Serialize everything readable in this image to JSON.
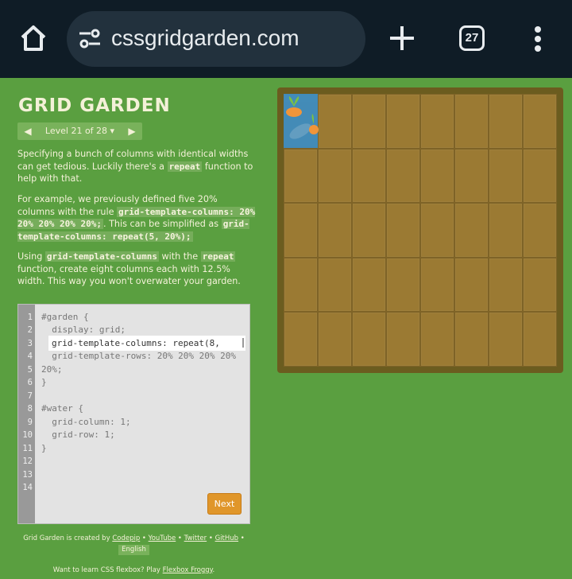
{
  "browser": {
    "url": "cssgridgarden.com",
    "tab_count": "27",
    "icons": [
      "home-icon",
      "site-info-icon",
      "new-tab-icon",
      "tab-switcher-icon",
      "more-menu-icon"
    ]
  },
  "game": {
    "title": "GRID GARDEN",
    "level_label": "Level 21 of 28 ▾",
    "instructions": {
      "p1_before": "Specifying a bunch of columns with identical widths can get tedious. Luckily there's a ",
      "p1_code": "repeat",
      "p1_after": " function to help with that.",
      "p2_before": "For example, we previously defined five 20% columns with the rule ",
      "p2_code1": "grid-template-columns: 20% 20% 20% 20% 20%;",
      "p2_mid": ". This can be simplified as ",
      "p2_code2": "grid-template-columns: repeat(5, 20%);",
      "p3_before": "Using ",
      "p3_code1": "grid-template-columns",
      "p3_mid": " with the ",
      "p3_code2": "repeat",
      "p3_after": " function, create eight columns each with 12.5% width. This way you won't overwater your garden."
    },
    "editor": {
      "line_numbers": [
        "1",
        "2",
        "3",
        "4",
        "5",
        "6",
        "7",
        "8",
        "9",
        "10",
        "11",
        "12",
        "13",
        "14"
      ],
      "lines": {
        "l1": "#garden {",
        "l2": "  display: grid;",
        "l4": "  grid-template-rows: 20% 20% 20% 20%",
        "l5": "20%;",
        "l6": "}",
        "l8": "#water {",
        "l9": "  grid-column: 1;",
        "l10": "  grid-row: 1;",
        "l11": "}"
      },
      "input_value": "grid-template-columns: repeat(8,",
      "next_label": "Next"
    },
    "credits": {
      "prefix": "Grid Garden is created by ",
      "codepip": "Codepip",
      "sep1": " • ",
      "youtube": "YouTube",
      "sep2": " • ",
      "twitter": "Twitter",
      "sep3": " • ",
      "github": "GitHub",
      "sep4": " •",
      "language": "English"
    },
    "promo": {
      "text": "Want to learn CSS flexbox? Play ",
      "link": "Flexbox Froggy",
      "end": "."
    },
    "garden": {
      "columns": 8,
      "rows": 5,
      "colors": {
        "soil": "#9b7a33",
        "border": "#6b5c1f",
        "water": "#3c8dc3"
      }
    }
  }
}
